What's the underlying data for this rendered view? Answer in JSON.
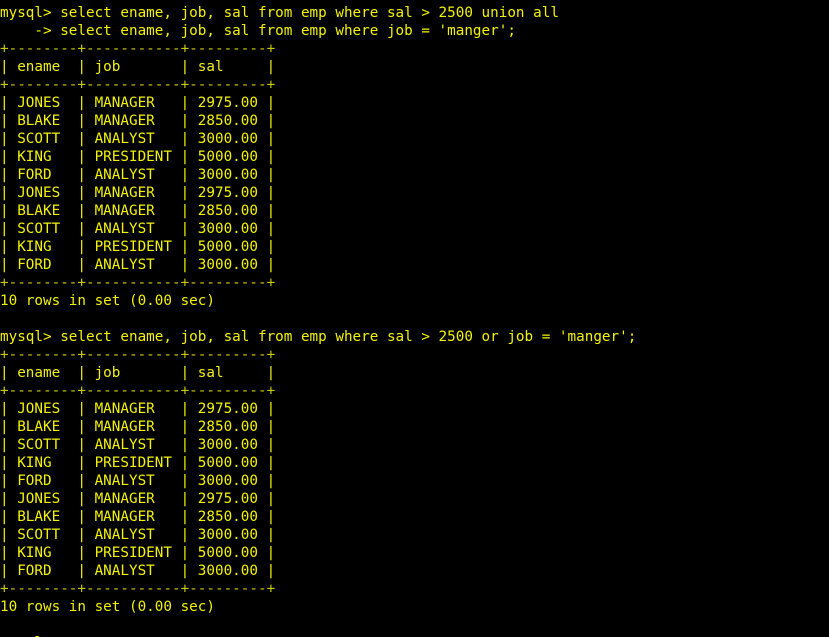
{
  "terminal": {
    "app": "mysql",
    "prompt": "mysql>",
    "continuation_prompt": "    ->",
    "background_color": "#000000",
    "text_color": "#f2f200",
    "border_color": "#c8c800",
    "columns": 91,
    "rows": 35
  },
  "queries": [
    {
      "id": "query-1",
      "lines": [
        "mysql> select ename, job, sal from emp where sal > 2500 union all",
        "    -> select ename, job, sal from emp where job = 'manger';"
      ]
    },
    {
      "id": "query-2",
      "lines": [
        "mysql> select ename, job, sal from emp where sal > 2500 or job = 'manger';"
      ]
    }
  ],
  "result_table": {
    "rule": "+--------+-----------+---------+",
    "header_row": "| ename  | job       | sal     |",
    "columns": [
      "ename",
      "job",
      "sal"
    ],
    "rows": [
      [
        "JONES",
        "MANAGER",
        "2975.00"
      ],
      [
        "BLAKE",
        "MANAGER",
        "2850.00"
      ],
      [
        "SCOTT",
        "ANALYST",
        "3000.00"
      ],
      [
        "KING",
        "PRESIDENT",
        "5000.00"
      ],
      [
        "FORD",
        "ANALYST",
        "3000.00"
      ],
      [
        "JONES",
        "MANAGER",
        "2975.00"
      ],
      [
        "BLAKE",
        "MANAGER",
        "2850.00"
      ],
      [
        "SCOTT",
        "ANALYST",
        "3000.00"
      ],
      [
        "KING",
        "PRESIDENT",
        "5000.00"
      ],
      [
        "FORD",
        "ANALYST",
        "3000.00"
      ]
    ],
    "row_lines": [
      "| JONES  | MANAGER   | 2975.00 |",
      "| BLAKE  | MANAGER   | 2850.00 |",
      "| SCOTT  | ANALYST   | 3000.00 |",
      "| KING   | PRESIDENT | 5000.00 |",
      "| FORD   | ANALYST   | 3000.00 |",
      "| JONES  | MANAGER   | 2975.00 |",
      "| BLAKE  | MANAGER   | 2850.00 |",
      "| SCOTT  | ANALYST   | 3000.00 |",
      "| KING   | PRESIDENT | 5000.00 |",
      "| FORD   | ANALYST   | 3000.00 |"
    ],
    "status": "10 rows in set (0.00 sec)",
    "row_count": 10,
    "elapsed_sec": "0.00"
  },
  "screen_lines": [
    {
      "name": "query-1-line-1",
      "class": "cmd",
      "text": "mysql> select ename, job, sal from emp where sal > 2500 union all"
    },
    {
      "name": "query-1-line-2",
      "class": "cmd",
      "text": "    -> select ename, job, sal from emp where job = 'manger';"
    },
    {
      "name": "table-1-top-rule",
      "class": "rule",
      "text": "+--------+-----------+---------+"
    },
    {
      "name": "table-1-header",
      "class": "header",
      "text": "| ename  | job       | sal     |"
    },
    {
      "name": "table-1-header-rule",
      "class": "rule",
      "text": "+--------+-----------+---------+"
    },
    {
      "name": "table-1-row-1",
      "class": "row",
      "text": "| JONES  | MANAGER   | 2975.00 |"
    },
    {
      "name": "table-1-row-2",
      "class": "row",
      "text": "| BLAKE  | MANAGER   | 2850.00 |"
    },
    {
      "name": "table-1-row-3",
      "class": "row",
      "text": "| SCOTT  | ANALYST   | 3000.00 |"
    },
    {
      "name": "table-1-row-4",
      "class": "row",
      "text": "| KING   | PRESIDENT | 5000.00 |"
    },
    {
      "name": "table-1-row-5",
      "class": "row",
      "text": "| FORD   | ANALYST   | 3000.00 |"
    },
    {
      "name": "table-1-row-6",
      "class": "row",
      "text": "| JONES  | MANAGER   | 2975.00 |"
    },
    {
      "name": "table-1-row-7",
      "class": "row",
      "text": "| BLAKE  | MANAGER   | 2850.00 |"
    },
    {
      "name": "table-1-row-8",
      "class": "row",
      "text": "| SCOTT  | ANALYST   | 3000.00 |"
    },
    {
      "name": "table-1-row-9",
      "class": "row",
      "text": "| KING   | PRESIDENT | 5000.00 |"
    },
    {
      "name": "table-1-row-10",
      "class": "row",
      "text": "| FORD   | ANALYST   | 3000.00 |"
    },
    {
      "name": "table-1-bottom-rule",
      "class": "rule",
      "text": "+--------+-----------+---------+"
    },
    {
      "name": "table-1-status",
      "class": "status",
      "text": "10 rows in set (0.00 sec)"
    },
    {
      "name": "spacer-1",
      "class": "blank",
      "text": " "
    },
    {
      "name": "query-2-line-1",
      "class": "cmd",
      "text": "mysql> select ename, job, sal from emp where sal > 2500 or job = 'manger';"
    },
    {
      "name": "table-2-top-rule",
      "class": "rule",
      "text": "+--------+-----------+---------+"
    },
    {
      "name": "table-2-header",
      "class": "header",
      "text": "| ename  | job       | sal     |"
    },
    {
      "name": "table-2-header-rule",
      "class": "rule",
      "text": "+--------+-----------+---------+"
    },
    {
      "name": "table-2-row-1",
      "class": "row",
      "text": "| JONES  | MANAGER   | 2975.00 |"
    },
    {
      "name": "table-2-row-2",
      "class": "row",
      "text": "| BLAKE  | MANAGER   | 2850.00 |"
    },
    {
      "name": "table-2-row-3",
      "class": "row",
      "text": "| SCOTT  | ANALYST   | 3000.00 |"
    },
    {
      "name": "table-2-row-4",
      "class": "row",
      "text": "| KING   | PRESIDENT | 5000.00 |"
    },
    {
      "name": "table-2-row-5",
      "class": "row",
      "text": "| FORD   | ANALYST   | 3000.00 |"
    },
    {
      "name": "table-2-row-6",
      "class": "row",
      "text": "| JONES  | MANAGER   | 2975.00 |"
    },
    {
      "name": "table-2-row-7",
      "class": "row",
      "text": "| BLAKE  | MANAGER   | 2850.00 |"
    },
    {
      "name": "table-2-row-8",
      "class": "row",
      "text": "| SCOTT  | ANALYST   | 3000.00 |"
    },
    {
      "name": "table-2-row-9",
      "class": "row",
      "text": "| KING   | PRESIDENT | 5000.00 |"
    },
    {
      "name": "table-2-row-10",
      "class": "row",
      "text": "| FORD   | ANALYST   | 3000.00 |"
    },
    {
      "name": "table-2-bottom-rule",
      "class": "rule",
      "text": "+--------+-----------+---------+"
    },
    {
      "name": "table-2-status",
      "class": "status",
      "text": "10 rows in set (0.00 sec)"
    },
    {
      "name": "spacer-2",
      "class": "blank",
      "text": " "
    },
    {
      "name": "prompt-line-clipped",
      "class": "cmd clipped",
      "text": "mysql>"
    }
  ]
}
